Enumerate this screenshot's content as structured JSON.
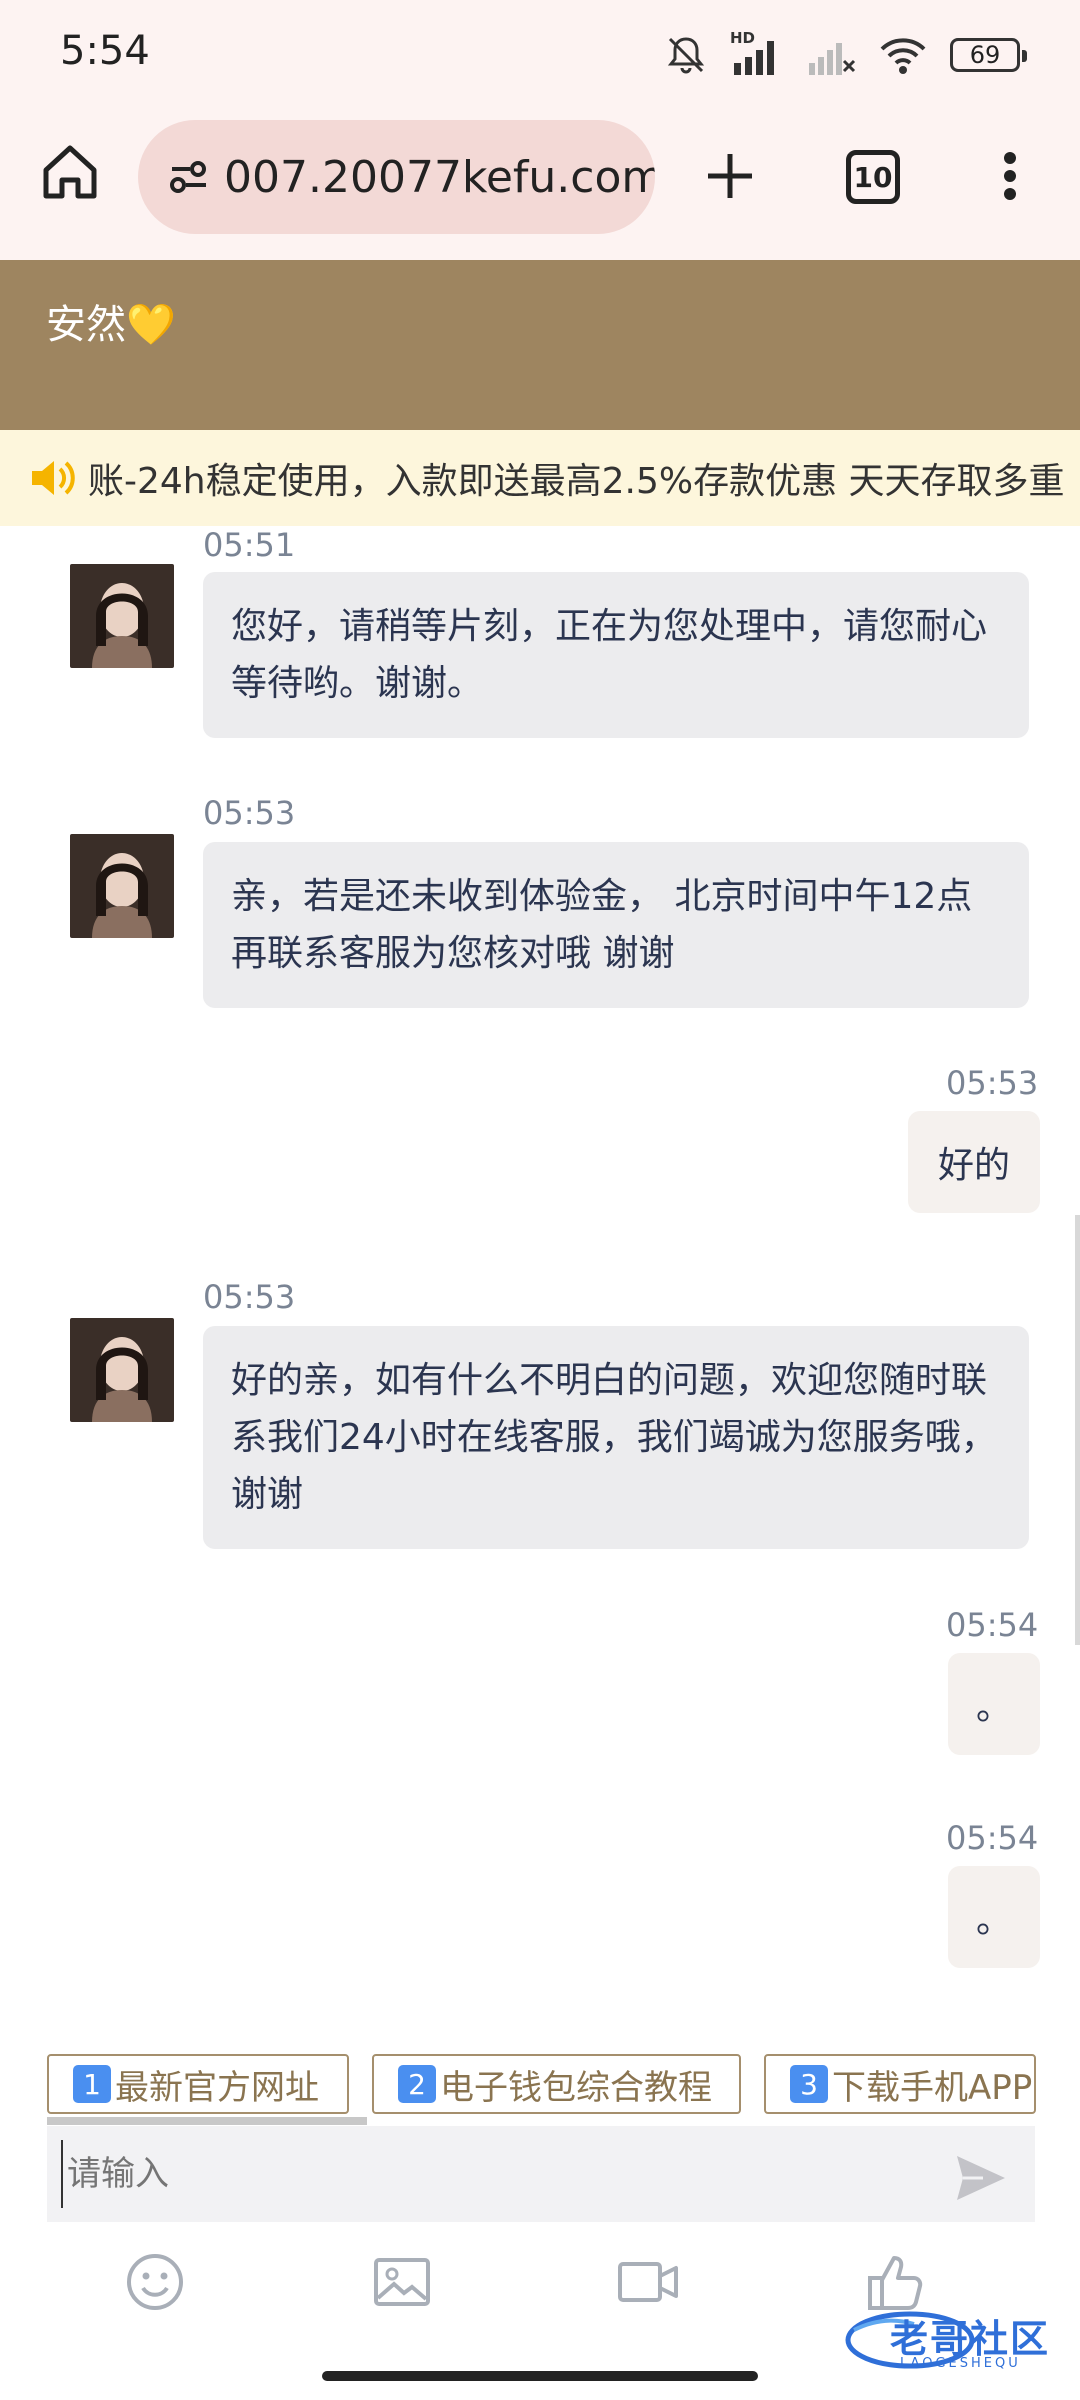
{
  "status_bar": {
    "time": "5:54",
    "battery": "69",
    "network_label": "HD"
  },
  "browser": {
    "url": "007.20077kefu.com",
    "tab_count": "10"
  },
  "chat": {
    "title": "安然💛"
  },
  "notice": {
    "text": "账-24h稳定使用，入款即送最高2.5%存款优惠 天天存取多重"
  },
  "messages": [
    {
      "side": "in",
      "time": "05:51",
      "text": "您好，请稍等片刻，正在为您处理中，请您耐心等待哟。谢谢。"
    },
    {
      "side": "in",
      "time": "05:53",
      "text": "亲，若是还未收到体验金， 北京时间中午12点再联系客服为您核对哦 谢谢"
    },
    {
      "side": "out",
      "time": "05:53",
      "text": "好的"
    },
    {
      "side": "in",
      "time": "05:53",
      "text": "好的亲，如有什么不明白的问题，欢迎您随时联系我们24小时在线客服，我们竭诚为您服务哦，谢谢"
    },
    {
      "side": "out",
      "time": "05:54",
      "text": "。"
    },
    {
      "side": "out",
      "time": "05:54",
      "text": "。"
    }
  ],
  "quick_replies": [
    {
      "num": "1",
      "label": "最新官方网址"
    },
    {
      "num": "2",
      "label": "电子钱包综合教程"
    },
    {
      "num": "3",
      "label": "下载手机APP"
    }
  ],
  "input": {
    "placeholder": "请输入"
  },
  "toolbar_icons": [
    "emoji-icon",
    "image-icon",
    "video-icon",
    "thumbs-up-icon"
  ],
  "watermark": {
    "text": "老哥社区",
    "sub": "LAOGESHEQU"
  },
  "colors": {
    "header": "#9e8560",
    "notice_bg": "#fdf6dc",
    "accent_border": "#a58f6d",
    "chrome_bg": "#fdf3f2"
  }
}
